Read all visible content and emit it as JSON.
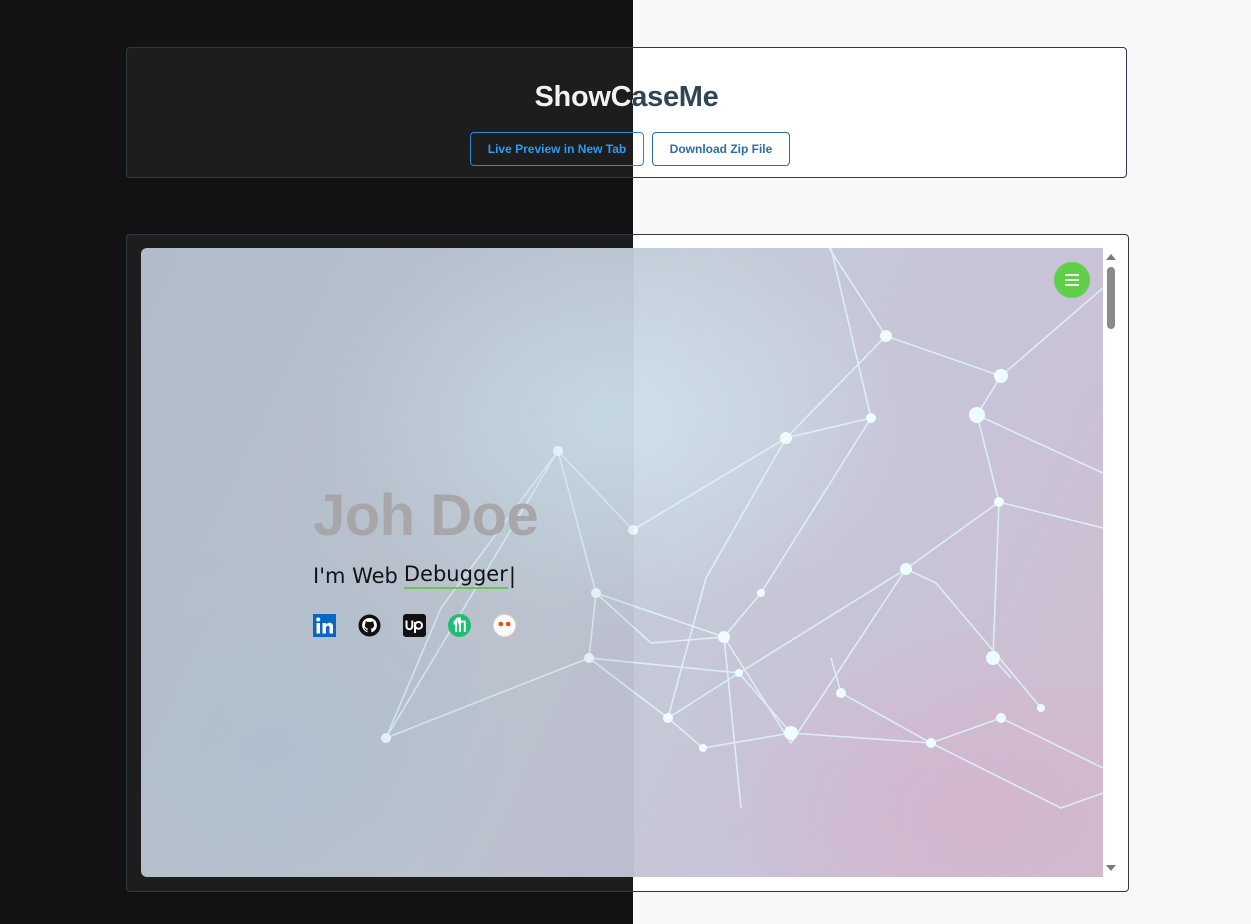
{
  "header": {
    "title": "ShowCaseMe",
    "live_preview_label": "Live Preview in New Tab",
    "download_label": "Download Zip File"
  },
  "preview": {
    "name": "Joh Doe",
    "role_prefix": "I'm Web",
    "role_typed": "Debugger",
    "cursor": "|",
    "menu_icon": "hamburger-icon",
    "accent_color": "#5fcf4a",
    "socials": [
      {
        "icon": "linkedin-icon",
        "color": "#0a66c2"
      },
      {
        "icon": "github-icon",
        "color": "#111111"
      },
      {
        "icon": "upwork-icon",
        "color": "#111111"
      },
      {
        "icon": "fiverr-icon",
        "color": "#1dbf73"
      },
      {
        "icon": "reddit-icon",
        "color": "#ff4500"
      }
    ]
  },
  "colors": {
    "dark_bg": "#121212",
    "light_bg": "#f8f8f8",
    "button_border": "#2b8ad8"
  }
}
